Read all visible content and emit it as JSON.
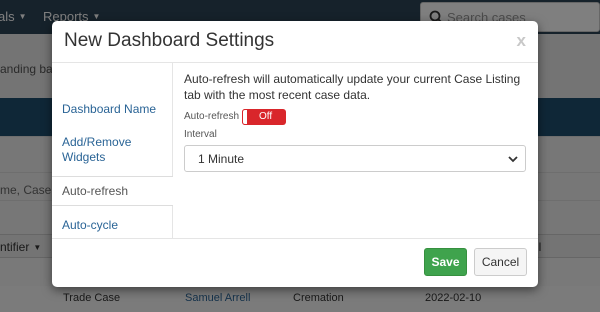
{
  "nav": {
    "item1": "als",
    "item2": "Reports",
    "search_placeholder": "Search cases"
  },
  "background": {
    "band_text": "anding ba",
    "filter_text": "me, Case N",
    "header_cells": [
      "ntifier",
      "ll"
    ],
    "row": {
      "type": "Trade Case",
      "person": "Samuel Arrell",
      "service": "Cremation",
      "date": "2022-02-10"
    }
  },
  "modal": {
    "title": "New Dashboard Settings",
    "close": "x",
    "side_nav": [
      {
        "label": "Dashboard Name"
      },
      {
        "label": "Add/Remove Widgets"
      },
      {
        "label": "Auto-refresh"
      },
      {
        "label": "Auto-cycle"
      }
    ],
    "description": "Auto-refresh will automatically update your current Case Listing tab with the most recent case data.",
    "autorefresh_label": "Auto-refresh",
    "toggle_state": "Off",
    "interval_label": "Interval",
    "interval_value": "1 Minute",
    "save": "Save",
    "cancel": "Cancel"
  },
  "colors": {
    "nav_bg": "#2c4456",
    "toggle_off": "#d9262b",
    "save_green": "#3fa34d",
    "link_blue": "#2a6496"
  }
}
